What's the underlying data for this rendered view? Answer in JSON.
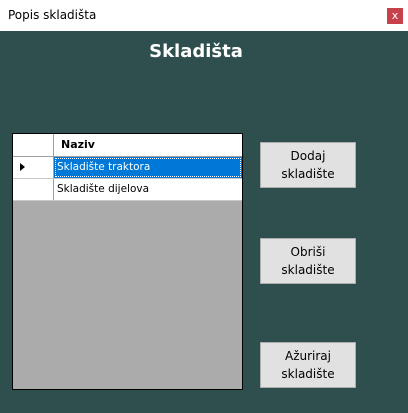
{
  "window": {
    "title": "Popis skladišta",
    "close_glyph": "x"
  },
  "form": {
    "title": "Skladišta"
  },
  "grid": {
    "column_header": "Naziv",
    "rows": [
      {
        "name": "Skladište traktora"
      },
      {
        "name": "Skladište dijelova"
      }
    ]
  },
  "buttons": {
    "add": {
      "line1": "Dodaj",
      "line2": "skladište"
    },
    "delete": {
      "line1": "Obriši",
      "line2": "skladište"
    },
    "update": {
      "line1": "Ažuriraj",
      "line2": "skladište"
    }
  },
  "colors": {
    "form_background": "#2f4f4f",
    "selection": "#0078d7",
    "close_button": "#c7414b"
  },
  "icons": {
    "close": "close-icon",
    "row_indicator": "current-row-arrow-icon"
  }
}
